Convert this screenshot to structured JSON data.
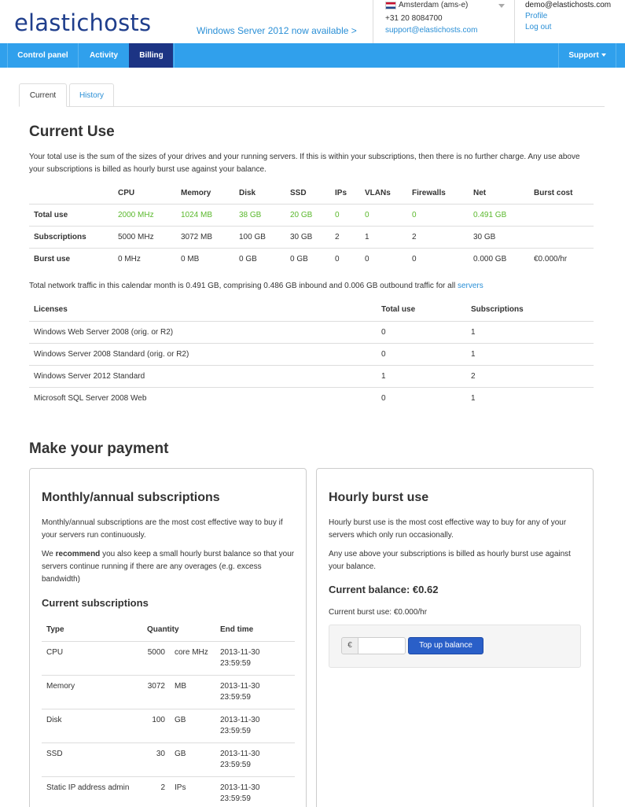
{
  "header": {
    "logo": "elastichosts",
    "promo": "Windows Server 2012 now available >",
    "region": "Amsterdam (ams-e)",
    "phone": "+31 20 8084700",
    "support_email": "support@elastichosts.com",
    "user_email": "demo@elastichosts.com",
    "profile_label": "Profile",
    "logout_label": "Log out"
  },
  "nav": {
    "control_panel": "Control panel",
    "activity": "Activity",
    "billing": "Billing",
    "support": "Support"
  },
  "tabs": {
    "current": "Current",
    "history": "History"
  },
  "current_use": {
    "title": "Current Use",
    "intro": "Your total use is the sum of the sizes of your drives and your running servers. If this is within your subscriptions, then there is no further charge. Any use above your subscriptions is billed as hourly burst use against your balance.",
    "columns": [
      "",
      "CPU",
      "Memory",
      "Disk",
      "SSD",
      "IPs",
      "VLANs",
      "Firewalls",
      "Net",
      "Burst cost"
    ],
    "rows": [
      {
        "label": "Total use",
        "cells": [
          "2000 MHz",
          "1024 MB",
          "38 GB",
          "20 GB",
          "0",
          "0",
          "0",
          "0.491 GB",
          ""
        ]
      },
      {
        "label": "Subscriptions",
        "cells": [
          "5000 MHz",
          "3072 MB",
          "100 GB",
          "30 GB",
          "2",
          "1",
          "2",
          "30 GB",
          ""
        ]
      },
      {
        "label": "Burst use",
        "cells": [
          "0 MHz",
          "0 MB",
          "0 GB",
          "0 GB",
          "0",
          "0",
          "0",
          "0.000 GB",
          "€0.000/hr"
        ]
      }
    ],
    "traffic_text": "Total network traffic in this calendar month is 0.491 GB, comprising 0.486 GB inbound and 0.006 GB outbound traffic for all",
    "traffic_link": "servers"
  },
  "licenses": {
    "columns": [
      "Licenses",
      "Total use",
      "Subscriptions"
    ],
    "rows": [
      [
        "Windows Web Server 2008 (orig. or R2)",
        "0",
        "1"
      ],
      [
        "Windows Server 2008 Standard (orig. or R2)",
        "0",
        "1"
      ],
      [
        "Windows Server 2012 Standard",
        "1",
        "2"
      ],
      [
        "Microsoft SQL Server 2008 Web",
        "0",
        "1"
      ]
    ]
  },
  "payment": {
    "title": "Make your payment",
    "monthly": {
      "title": "Monthly/annual subscriptions",
      "p1": "Monthly/annual subscriptions are the most cost effective way to buy if your servers run continuously.",
      "p2_pre": "We",
      "p2_strong": "recommend",
      "p2_post": "you also keep a small hourly burst balance so that your servers continue running if there are any overages (e.g. excess bandwidth)",
      "subs_title": "Current subscriptions",
      "columns": [
        "Type",
        "Quantity",
        "",
        "End time"
      ],
      "rows": [
        [
          "CPU",
          "5000",
          "core MHz",
          "2013-11-30",
          "23:59:59"
        ],
        [
          "Memory",
          "3072",
          "MB",
          "2013-11-30",
          "23:59:59"
        ],
        [
          "Disk",
          "100",
          "GB",
          "2013-11-30",
          "23:59:59"
        ],
        [
          "SSD",
          "30",
          "GB",
          "2013-11-30",
          "23:59:59"
        ],
        [
          "Static IP address admin",
          "2",
          "IPs",
          "2013-11-30",
          "23:59:59"
        ]
      ]
    },
    "hourly": {
      "title": "Hourly burst use",
      "p1": "Hourly burst use is the most cost effective way to buy for any of your servers which only run occasionally.",
      "p2": "Any use above your subscriptions is billed as hourly burst use against your balance.",
      "balance": "Current balance: €0.62",
      "burst": "Current burst use: €0.000/hr",
      "currency": "€",
      "amount_value": "",
      "topup_label": "Top up balance"
    }
  }
}
